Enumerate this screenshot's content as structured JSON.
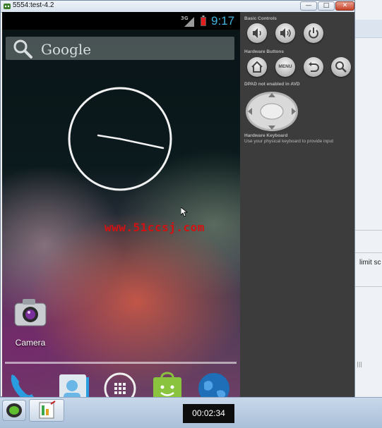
{
  "window": {
    "title": "5554:test-4.2",
    "minimize_label": "—",
    "maximize_label": "□",
    "close_label": "✕"
  },
  "status_bar": {
    "network": "3G",
    "clock": "9:17",
    "battery_color": "#e02020",
    "clock_color": "#3fb4e0"
  },
  "search": {
    "text": "Google",
    "icon": "search-icon"
  },
  "watermark": "www.51ccsj.com",
  "apps": [
    {
      "label": "Camera",
      "icon": "camera-icon"
    }
  ],
  "dock": [
    {
      "icon": "phone-icon"
    },
    {
      "icon": "contacts-icon"
    },
    {
      "icon": "all-apps-icon"
    },
    {
      "icon": "play-store-icon"
    },
    {
      "icon": "browser-globe-icon"
    }
  ],
  "controls": {
    "basic_controls_label": "Basic Controls",
    "basic_buttons": [
      "volume-down-icon",
      "volume-up-icon",
      "power-icon"
    ],
    "hardware_buttons_label": "Hardware Buttons",
    "hardware_buttons": [
      "home-icon",
      "menu-button",
      "back-icon",
      "search-icon"
    ],
    "menu_label": "MENU",
    "dpad_label": "DPAD not enabled in AVD",
    "keyboard_label": "Hardware Keyboard",
    "keyboard_hint": "Use your physical keyboard to provide input"
  },
  "background_window": {
    "text": "limit sc",
    "scroll_label": "|||"
  },
  "taskbar": {
    "timer": "00:02:34"
  }
}
